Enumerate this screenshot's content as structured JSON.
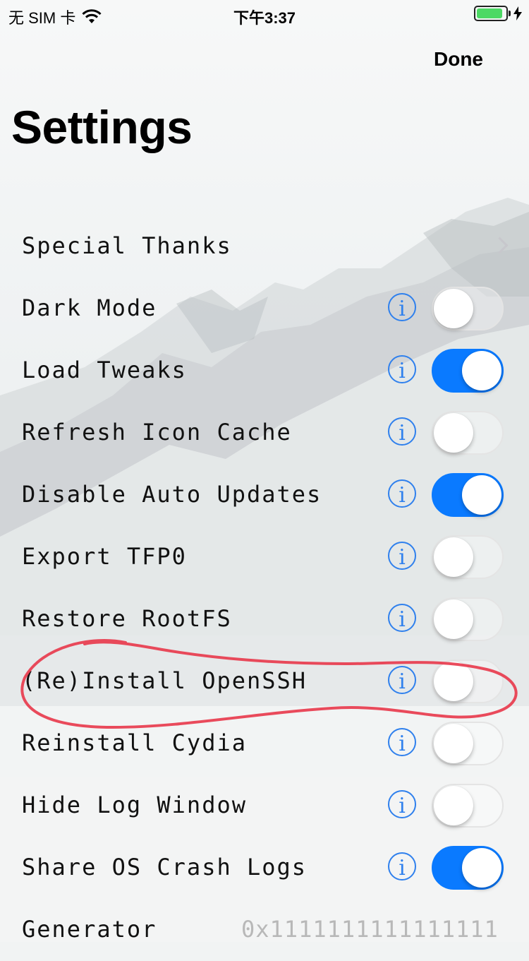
{
  "status_bar": {
    "carrier": "无 SIM 卡",
    "time": "下午3:37",
    "battery_level": 1.0,
    "icons": [
      "wifi-icon",
      "battery-icon",
      "charging-bolt-icon"
    ]
  },
  "nav": {
    "done_label": "Done"
  },
  "page": {
    "title": "Settings"
  },
  "settings": [
    {
      "label": "Special Thanks",
      "control": "disclosure"
    },
    {
      "label": "Dark Mode",
      "control": "toggle",
      "on": false,
      "info": "i"
    },
    {
      "label": "Load Tweaks",
      "control": "toggle",
      "on": true,
      "info": "i"
    },
    {
      "label": "Refresh Icon Cache",
      "control": "toggle",
      "on": false,
      "info": "i"
    },
    {
      "label": "Disable Auto Updates",
      "control": "toggle",
      "on": true,
      "info": "i"
    },
    {
      "label": "Export TFP0",
      "control": "toggle",
      "on": false,
      "info": "i"
    },
    {
      "label": "Restore RootFS",
      "control": "toggle",
      "on": false,
      "info": "i"
    },
    {
      "label": "(Re)Install OpenSSH",
      "control": "toggle",
      "on": false,
      "info": "i"
    },
    {
      "label": "Reinstall Cydia",
      "control": "toggle",
      "on": false,
      "info": "i"
    },
    {
      "label": "Hide Log Window",
      "control": "toggle",
      "on": false,
      "info": "i"
    },
    {
      "label": "Share OS Crash Logs",
      "control": "toggle",
      "on": true,
      "info": "i"
    },
    {
      "label": "Generator",
      "control": "value",
      "value": "0x1111111111111111"
    }
  ],
  "colors": {
    "accent": "#0a7aff",
    "info": "#2f80ed",
    "annotation": "#e8374a"
  }
}
